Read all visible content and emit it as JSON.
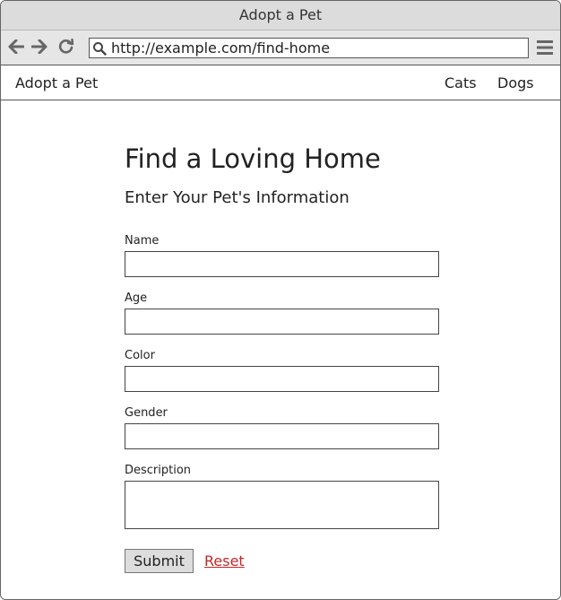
{
  "window": {
    "title": "Adopt a Pet"
  },
  "browser": {
    "url": "http://example.com/find-home"
  },
  "site_nav": {
    "brand": "Adopt a Pet",
    "links": [
      "Cats",
      "Dogs"
    ]
  },
  "page": {
    "heading": "Find a Loving Home",
    "subheading": "Enter Your Pet's Information"
  },
  "form": {
    "fields": {
      "name": {
        "label": "Name",
        "value": ""
      },
      "age": {
        "label": "Age",
        "value": ""
      },
      "color": {
        "label": "Color",
        "value": ""
      },
      "gender": {
        "label": "Gender",
        "value": ""
      },
      "description": {
        "label": "Description",
        "value": ""
      }
    },
    "submit_label": "Submit",
    "reset_label": "Reset"
  },
  "colors": {
    "reset_link": "#c0282a",
    "titlebar_bg": "#dcdcdc",
    "toolbar_bg": "#e6e6e6"
  },
  "icons": [
    "back-arrow-icon",
    "forward-arrow-icon",
    "reload-icon",
    "search-icon",
    "hamburger-menu-icon"
  ]
}
